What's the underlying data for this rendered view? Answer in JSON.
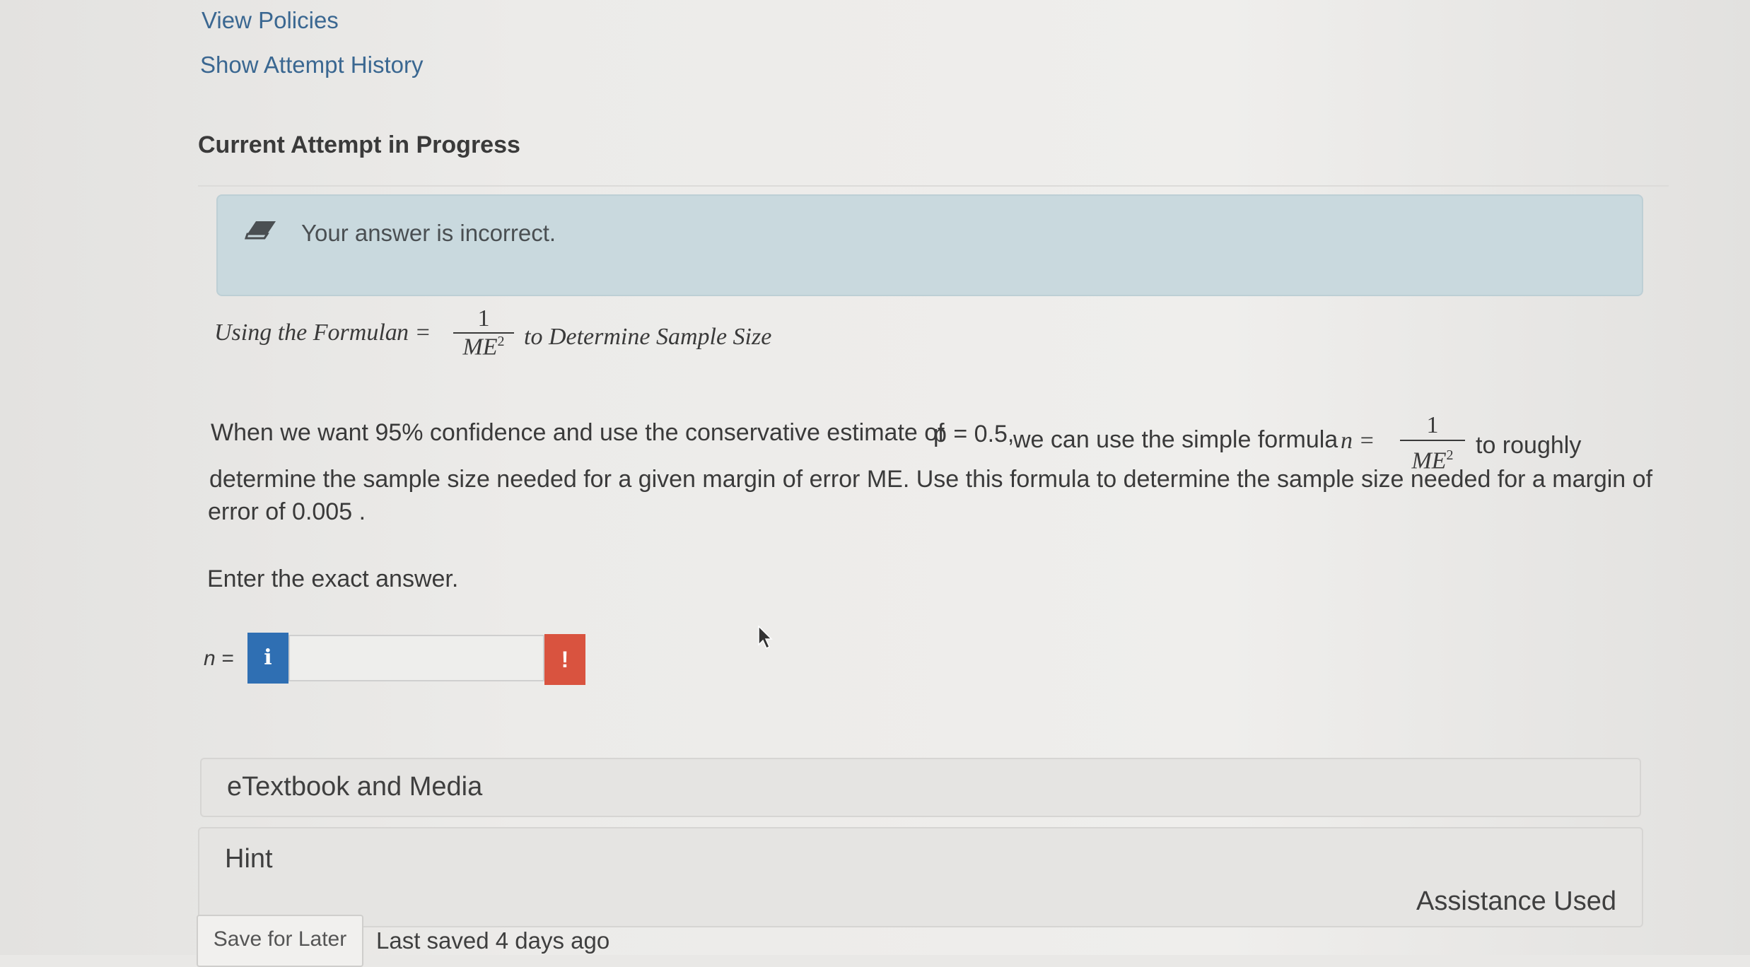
{
  "links": {
    "view_policies": "View Policies",
    "show_attempt_history": "Show Attempt History"
  },
  "attempt": {
    "title": "Current Attempt in Progress"
  },
  "feedback": {
    "message": "Your answer is incorrect.",
    "icon": "eraser-icon",
    "bg_color": "#c9d9de"
  },
  "question": {
    "heading_prefix": "Using the Formula",
    "heading_var": "n =",
    "heading_suffix": "to Determine Sample Size",
    "formula_num": "1",
    "formula_den": "ME",
    "formula_exp": "2",
    "para_line1_a": "When we want 95% confidence and use the conservative estimate of",
    "para_line1_p": "p = 0.5,",
    "para_line1_b": "we can use the simple formula",
    "para_line1_n": "n =",
    "para_line1_c": "to roughly",
    "para_line2": "determine the sample size needed for a given margin of error ME. Use this formula to determine the sample size needed for a margin of",
    "para_line3": "error of 0.005 .",
    "instruction": "Enter the exact answer."
  },
  "answer": {
    "label": "n =",
    "info_glyph": "i",
    "value": "",
    "warn_glyph": "!"
  },
  "panels": {
    "etextbook": "eTextbook and Media",
    "hint": "Hint",
    "assistance": "Assistance Used"
  },
  "footer": {
    "save_label": "Save for Later",
    "last_saved": "Last saved 4 days ago"
  },
  "colors": {
    "link": "#3a6791",
    "info": "#2f6fb3",
    "warning": "#d9533f"
  }
}
